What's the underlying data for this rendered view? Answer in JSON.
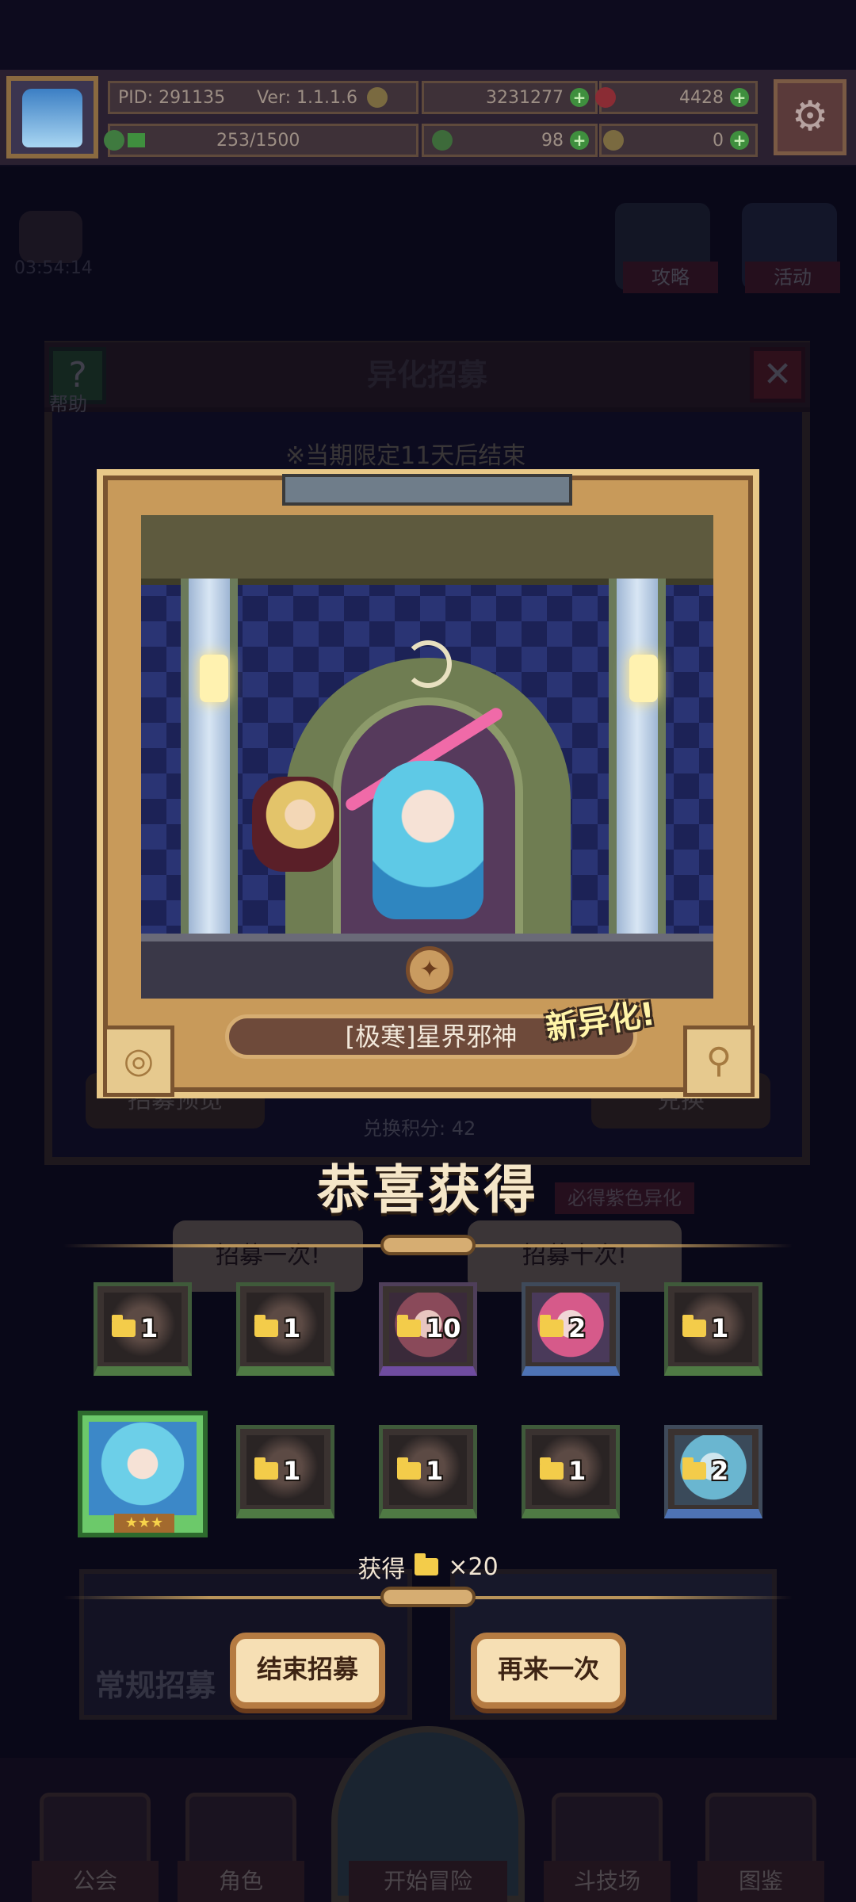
{
  "hud": {
    "pid": "PID: 291135",
    "version": "Ver: 1.1.1.6",
    "exp": "253/1500",
    "gold": "3231277",
    "gems": "4428",
    "clover": "98",
    "tickets": "0"
  },
  "background": {
    "timer": "03:54:14",
    "guide": "攻略",
    "event": "活动",
    "help": "帮助",
    "recruit_title": "异化招募",
    "limit_notice": "※当期限定11天后结束",
    "points": "兑换积分: 42",
    "preview": "招募预览",
    "exchange": "兑换",
    "purple_guarantee": "必得紫色异化",
    "recruit_once": "招募一次!",
    "recruit_ten": "招募十次!",
    "regular_recruit": "常规招募"
  },
  "result": {
    "character_name": "[极寒]星界邪神",
    "new_tag": "新异化!",
    "congrats": "恭喜获得",
    "big_reward_stars": "★★★",
    "rewards_row1": [
      "1",
      "1",
      "10",
      "2",
      "1"
    ],
    "rewards_row2": [
      "1",
      "1",
      "1",
      "2"
    ],
    "gain_label": "获得",
    "gain_amount": "×20",
    "end_button": "结束招募",
    "again_button": "再来一次"
  },
  "nav": {
    "guild": "公会",
    "role": "角色",
    "adventure": "开始冒险",
    "arena": "斗技场",
    "codex": "图鉴"
  },
  "colors": {
    "gold_frame": "#c89a5a",
    "reward_green": "#4f7a44",
    "reward_purple": "#6f4ca0",
    "reward_blue": "#4e73b5",
    "button": "#f6dfb4"
  }
}
